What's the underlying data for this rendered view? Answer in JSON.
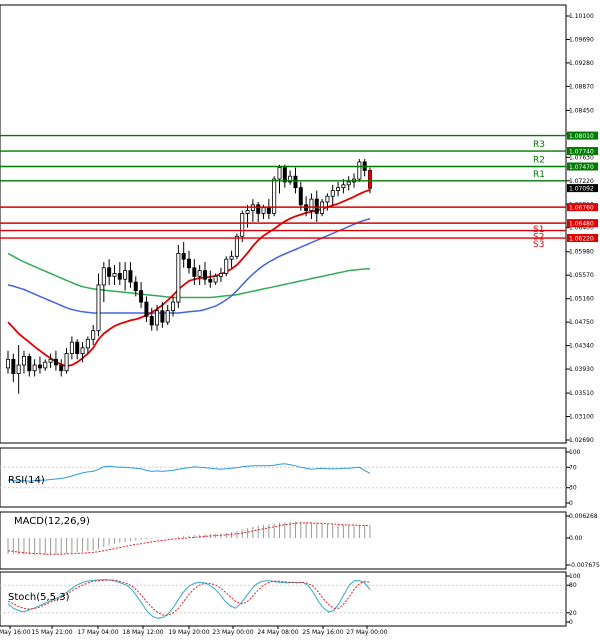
{
  "chart_data": [
    {
      "type": "candlestick",
      "panel": "price",
      "ylim": [
        1.0265,
        1.1035
      ],
      "y_ticks": [
        "1.10100",
        "1.09690",
        "1.09280",
        "1.08870",
        "1.08450",
        "1.08040",
        "1.07630",
        "1.07220",
        "1.06810",
        "1.06400",
        "1.05980",
        "1.05570",
        "1.05160",
        "1.04750",
        "1.04340",
        "1.03930",
        "1.03510",
        "1.03100",
        "1.02690"
      ],
      "x_ticks": [
        "14 May 16:00",
        "15 May 21:00",
        "17 May 04:00",
        "18 May 12:00",
        "19 May 20:00",
        "23 May 00:00",
        "24 May 08:00",
        "25 May 16:00",
        "27 May 00:00"
      ],
      "current_price": "1.07092",
      "candles": [
        [
          1.0395,
          1.0425,
          1.0385,
          1.041
        ],
        [
          1.041,
          1.042,
          1.037,
          1.0385
        ],
        [
          1.0385,
          1.0435,
          1.035,
          1.04
        ],
        [
          1.04,
          1.0425,
          1.0385,
          1.0415
        ],
        [
          1.0415,
          1.042,
          1.038,
          1.039
        ],
        [
          1.039,
          1.041,
          1.038,
          1.04
        ],
        [
          1.04,
          1.0415,
          1.0385,
          1.0395
        ],
        [
          1.0395,
          1.041,
          1.039,
          1.0405
        ],
        [
          1.0405,
          1.042,
          1.0395,
          1.041
        ],
        [
          1.041,
          1.0425,
          1.039,
          1.04
        ],
        [
          1.04,
          1.041,
          1.038,
          1.039
        ],
        [
          1.039,
          1.043,
          1.0385,
          1.042
        ],
        [
          1.042,
          1.045,
          1.041,
          1.044
        ],
        [
          1.044,
          1.0445,
          1.041,
          1.042
        ],
        [
          1.042,
          1.044,
          1.0405,
          1.043
        ],
        [
          1.043,
          1.045,
          1.042,
          1.0445
        ],
        [
          1.0445,
          1.047,
          1.0435,
          1.046
        ],
        [
          1.046,
          1.056,
          1.045,
          1.054
        ],
        [
          1.054,
          1.058,
          1.051,
          1.057
        ],
        [
          1.057,
          1.0585,
          1.054,
          1.0555
        ],
        [
          1.0555,
          1.0575,
          1.054,
          1.056
        ],
        [
          1.056,
          1.058,
          1.054,
          1.055
        ],
        [
          1.055,
          1.058,
          1.053,
          1.0565
        ],
        [
          1.0565,
          1.058,
          1.0535,
          1.0545
        ],
        [
          1.0545,
          1.0555,
          1.052,
          1.053
        ],
        [
          1.053,
          1.0545,
          1.05,
          1.051
        ],
        [
          1.051,
          1.052,
          1.0475,
          1.0485
        ],
        [
          1.0485,
          1.05,
          1.046,
          1.047
        ],
        [
          1.047,
          1.0505,
          1.046,
          1.0495
        ],
        [
          1.0495,
          1.051,
          1.0465,
          1.0475
        ],
        [
          1.0475,
          1.0505,
          1.047,
          1.0495
        ],
        [
          1.0495,
          1.052,
          1.0485,
          1.051
        ],
        [
          1.051,
          1.061,
          1.05,
          1.0595
        ],
        [
          1.0595,
          1.0615,
          1.057,
          1.0585
        ],
        [
          1.0585,
          1.06,
          1.056,
          1.057
        ],
        [
          1.057,
          1.0585,
          1.054,
          1.0555
        ],
        [
          1.0555,
          1.0575,
          1.054,
          1.0565
        ],
        [
          1.0565,
          1.058,
          1.054,
          1.055
        ],
        [
          1.055,
          1.0565,
          1.0535,
          1.0545
        ],
        [
          1.0545,
          1.056,
          1.054,
          1.0555
        ],
        [
          1.0555,
          1.057,
          1.0545,
          1.056
        ],
        [
          1.056,
          1.059,
          1.0555,
          1.0585
        ],
        [
          1.0585,
          1.06,
          1.057,
          1.059
        ],
        [
          1.059,
          1.063,
          1.0585,
          1.0625
        ],
        [
          1.0625,
          1.067,
          1.0615,
          1.0665
        ],
        [
          1.0665,
          1.068,
          1.064,
          1.067
        ],
        [
          1.067,
          1.069,
          1.065,
          1.068
        ],
        [
          1.068,
          1.0685,
          1.065,
          1.0665
        ],
        [
          1.0665,
          1.068,
          1.0655,
          1.0675
        ],
        [
          1.0675,
          1.069,
          1.0655,
          1.0665
        ],
        [
          1.0665,
          1.073,
          1.066,
          1.0725
        ],
        [
          1.0725,
          1.075,
          1.07,
          1.0745
        ],
        [
          1.0745,
          1.075,
          1.071,
          1.072
        ],
        [
          1.072,
          1.074,
          1.0715,
          1.073
        ],
        [
          1.073,
          1.0745,
          1.07,
          1.071
        ],
        [
          1.071,
          1.072,
          1.067,
          1.068
        ],
        [
          1.068,
          1.0695,
          1.066,
          1.067
        ],
        [
          1.067,
          1.07,
          1.0655,
          1.069
        ],
        [
          1.069,
          1.0705,
          1.065,
          1.0665
        ],
        [
          1.0665,
          1.069,
          1.066,
          1.0685
        ],
        [
          1.0685,
          1.07,
          1.067,
          1.0695
        ],
        [
          1.0695,
          1.0715,
          1.068,
          1.0705
        ],
        [
          1.0705,
          1.072,
          1.0695,
          1.071
        ],
        [
          1.071,
          1.0725,
          1.07,
          1.0715
        ],
        [
          1.0715,
          1.073,
          1.0705,
          1.072
        ],
        [
          1.072,
          1.0735,
          1.071,
          1.0725
        ],
        [
          1.0725,
          1.076,
          1.072,
          1.0755
        ],
        [
          1.0755,
          1.076,
          1.073,
          1.074
        ],
        [
          1.074,
          1.0745,
          1.07,
          1.0709
        ]
      ],
      "sr_levels": [
        {
          "name": "R3",
          "value": "1.07740",
          "color": "#007a00"
        },
        {
          "name": "R2",
          "value": "1.07470",
          "color": "#007a00"
        },
        {
          "name": "R1",
          "value": "",
          "color": "#007a00"
        },
        {
          "name": "",
          "value": "1.08010",
          "color": "#007a00"
        },
        {
          "name": "",
          "value": "1.06760",
          "color": "#dd0000"
        },
        {
          "name": "S1",
          "value": "1.06480",
          "color": "#dd0000"
        },
        {
          "name": "S2",
          "value": "",
          "color": "#dd0000"
        },
        {
          "name": "S3",
          "value": "1.06220",
          "color": "#dd0000"
        }
      ],
      "sr_values": [
        1.0774,
        1.0747,
        1.0722,
        1.0801,
        1.0676,
        1.0648,
        1.0635,
        1.0622
      ],
      "ma_red": [
        1.0475,
        1.0465,
        1.0455,
        1.0447,
        1.044,
        1.0432,
        1.0425,
        1.0418,
        1.0412,
        1.0406,
        1.0401,
        1.0398,
        1.04,
        1.0405,
        1.0412,
        1.042,
        1.043,
        1.0445,
        1.0455,
        1.0462,
        1.0468,
        1.0472,
        1.0475,
        1.0478,
        1.048,
        1.0483,
        1.0487,
        1.0492,
        1.0498,
        1.0505,
        1.0513,
        1.0522,
        1.0532,
        1.054,
        1.0547,
        1.055,
        1.0552,
        1.0553,
        1.0554,
        1.0556,
        1.0559,
        1.0563,
        1.0568,
        1.0575,
        1.0585,
        1.0596,
        1.0608,
        1.0618,
        1.0626,
        1.0632,
        1.0638,
        1.0645,
        1.0651,
        1.0656,
        1.066,
        1.0663,
        1.0666,
        1.0668,
        1.067,
        1.0673,
        1.0676,
        1.0679,
        1.0682,
        1.0686,
        1.069,
        1.0694,
        1.0699,
        1.0703,
        1.0706
      ],
      "ma_blue": [
        1.054,
        1.0538,
        1.0535,
        1.0532,
        1.0528,
        1.0524,
        1.052,
        1.0516,
        1.0512,
        1.0508,
        1.0504,
        1.05,
        1.0497,
        1.0495,
        1.0493,
        1.0492,
        1.0491,
        1.0491,
        1.0491,
        1.0491,
        1.0491,
        1.0491,
        1.0491,
        1.0491,
        1.0491,
        1.0491,
        1.0491,
        1.0491,
        1.0491,
        1.0491,
        1.0491,
        1.0491,
        1.0491,
        1.0492,
        1.0493,
        1.0494,
        1.0495,
        1.0497,
        1.05,
        1.0503,
        1.0508,
        1.0514,
        1.0521,
        1.053,
        1.054,
        1.055,
        1.0559,
        1.0567,
        1.0574,
        1.058,
        1.0585,
        1.059,
        1.0594,
        1.0598,
        1.0602,
        1.0606,
        1.061,
        1.0614,
        1.0618,
        1.0622,
        1.0626,
        1.063,
        1.0634,
        1.0638,
        1.0642,
        1.0646,
        1.065,
        1.0653,
        1.0656
      ],
      "ma_green": [
        1.0595,
        1.059,
        1.0585,
        1.058,
        1.0576,
        1.0572,
        1.0568,
        1.0564,
        1.056,
        1.0556,
        1.0552,
        1.0548,
        1.0544,
        1.054,
        1.0537,
        1.0535,
        1.0533,
        1.0532,
        1.0531,
        1.053,
        1.0529,
        1.0528,
        1.0527,
        1.0526,
        1.0525,
        1.0524,
        1.0523,
        1.0522,
        1.0521,
        1.052,
        1.0519,
        1.0518,
        1.0518,
        1.0518,
        1.0518,
        1.0518,
        1.0518,
        1.0518,
        1.0518,
        1.0519,
        1.052,
        1.0521,
        1.0522,
        1.0523,
        1.0525,
        1.0527,
        1.0529,
        1.0531,
        1.0533,
        1.0535,
        1.0537,
        1.0539,
        1.0541,
        1.0543,
        1.0545,
        1.0547,
        1.0549,
        1.0551,
        1.0553,
        1.0555,
        1.0557,
        1.0559,
        1.0561,
        1.0563,
        1.0565,
        1.0566,
        1.0567,
        1.0568,
        1.0568
      ]
    },
    {
      "type": "line",
      "panel": "rsi",
      "name": "RSI(14)",
      "ylim": [
        0,
        100
      ],
      "y_ticks": [
        "100",
        "70",
        "30",
        "0"
      ],
      "values": [
        45,
        44,
        43,
        44,
        43,
        44,
        45,
        45,
        46,
        47,
        48,
        50,
        53,
        56,
        59,
        61,
        62,
        66,
        71,
        72,
        71,
        70,
        70,
        69,
        68,
        67,
        64,
        62,
        63,
        62,
        63,
        64,
        66,
        68,
        69,
        71,
        70,
        69,
        68,
        67,
        66,
        67,
        68,
        69,
        71,
        72,
        73,
        73,
        73,
        73,
        74,
        76,
        77,
        75,
        73,
        70,
        68,
        66,
        67,
        68,
        67,
        67,
        67,
        68,
        68,
        69,
        70,
        64,
        58
      ]
    },
    {
      "type": "bar",
      "panel": "macd",
      "name": "MACD(12,26,9)",
      "y_ticks": [
        "0.006268",
        "0.00",
        "-0.007675"
      ],
      "ylim": [
        -0.007675,
        0.006268
      ],
      "histogram": [
        -0.0045,
        -0.0046,
        -0.0046,
        -0.0047,
        -0.0047,
        -0.0047,
        -0.0047,
        -0.0047,
        -0.0046,
        -0.0046,
        -0.0045,
        -0.0044,
        -0.0043,
        -0.0041,
        -0.0039,
        -0.0037,
        -0.0035,
        -0.003,
        -0.0025,
        -0.0021,
        -0.0017,
        -0.0014,
        -0.0011,
        -0.0009,
        -0.0007,
        -0.0005,
        -0.0003,
        -0.0002,
        -0.0001,
        0.0,
        0.0001,
        0.0002,
        0.0004,
        0.0006,
        0.0007,
        0.0008,
        0.0009,
        0.001,
        0.0011,
        0.0012,
        0.0013,
        0.0015,
        0.0017,
        0.002,
        0.0024,
        0.0028,
        0.0032,
        0.0035,
        0.0037,
        0.0039,
        0.0041,
        0.0043,
        0.0045,
        0.0046,
        0.0046,
        0.0045,
        0.0044,
        0.0043,
        0.0042,
        0.0041,
        0.004,
        0.0039,
        0.0038,
        0.0037,
        0.0036,
        0.0036,
        0.0037,
        0.0036,
        0.0034
      ],
      "signal": [
        -0.0036,
        -0.0038,
        -0.004,
        -0.0042,
        -0.0043,
        -0.0044,
        -0.0045,
        -0.0046,
        -0.0046,
        -0.0046,
        -0.0046,
        -0.0045,
        -0.0045,
        -0.0044,
        -0.0043,
        -0.0042,
        -0.0041,
        -0.0039,
        -0.0036,
        -0.0033,
        -0.003,
        -0.0027,
        -0.0024,
        -0.0021,
        -0.0018,
        -0.0016,
        -0.0013,
        -0.0011,
        -0.0009,
        -0.0007,
        -0.0005,
        -0.0003,
        -0.0002,
        -0.0001,
        0.0001,
        0.0002,
        0.0003,
        0.0005,
        0.0006,
        0.0007,
        0.0008,
        0.0009,
        0.0011,
        0.0012,
        0.0014,
        0.0017,
        0.002,
        0.0023,
        0.0026,
        0.0029,
        0.0032,
        0.0035,
        0.0038,
        0.004,
        0.0042,
        0.0043,
        0.0043,
        0.0043,
        0.0042,
        0.0042,
        0.0041,
        0.004,
        0.0039,
        0.0038,
        0.0037,
        0.0037,
        0.0036,
        0.0036,
        0.0035
      ]
    },
    {
      "type": "line",
      "panel": "stoch",
      "name": "Stoch(5,5,3)",
      "ylim": [
        0,
        100
      ],
      "y_ticks": [
        "100",
        "80",
        "20",
        "0"
      ],
      "main": [
        40,
        30,
        25,
        22,
        26,
        30,
        35,
        40,
        45,
        50,
        55,
        62,
        70,
        78,
        84,
        88,
        90,
        91,
        92,
        92,
        91,
        88,
        84,
        80,
        70,
        55,
        38,
        22,
        12,
        8,
        10,
        18,
        32,
        50,
        66,
        78,
        84,
        86,
        85,
        80,
        72,
        60,
        45,
        35,
        30,
        40,
        55,
        70,
        82,
        88,
        90,
        89,
        87,
        86,
        85,
        86,
        85,
        86,
        80,
        65,
        45,
        30,
        22,
        25,
        40,
        60,
        80,
        90,
        90,
        85,
        70
      ],
      "signal": [
        45,
        40,
        34,
        30,
        28,
        29,
        32,
        37,
        42,
        47,
        52,
        58,
        65,
        72,
        78,
        83,
        87,
        89,
        90,
        91,
        91,
        90,
        87,
        84,
        78,
        68,
        55,
        42,
        30,
        20,
        15,
        15,
        20,
        30,
        45,
        60,
        72,
        80,
        84,
        84,
        81,
        75,
        65,
        55,
        45,
        40,
        42,
        52,
        65,
        76,
        84,
        88,
        89,
        88,
        87,
        86,
        86,
        86,
        84,
        78,
        65,
        50,
        38,
        30,
        30,
        40,
        55,
        72,
        84,
        88,
        86
      ]
    }
  ]
}
